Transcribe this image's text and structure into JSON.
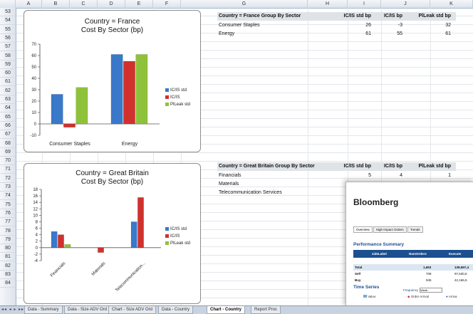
{
  "column_headers": [
    "A",
    "B",
    "C",
    "D",
    "E",
    "F",
    "G",
    "H",
    "I",
    "J",
    "K"
  ],
  "row_numbers": [
    "53",
    "54",
    "55",
    "56",
    "57",
    "58",
    "59",
    "60",
    "61",
    "62",
    "63",
    "64",
    "65",
    "66",
    "67",
    "68",
    "69",
    "70",
    "71",
    "72",
    "73",
    "74",
    "75",
    "76",
    "77",
    "78",
    "79",
    "80",
    "81",
    "82",
    "83",
    "84"
  ],
  "france_table": {
    "header": "Country = France Group By Sector",
    "col1": "IC/IS std bp",
    "col2": "IC/IS bp",
    "col3": "PlLeak std bp",
    "rows": [
      {
        "sector": "Consumer Staples",
        "v1": "26",
        "v2": "-3",
        "v3": "32"
      },
      {
        "sector": "Energy",
        "v1": "61",
        "v2": "55",
        "v3": "61"
      }
    ]
  },
  "gb_table": {
    "header": "Country = Great Britain Group By Sector",
    "col1": "IC/IS std bp",
    "col2": "IC/IS bp",
    "col3": "PlLeak std bp",
    "rows": [
      {
        "sector": "Financials",
        "v1": "5",
        "v2": "4",
        "v3": "1"
      },
      {
        "sector": "Materials",
        "v1": "",
        "v2": "",
        "v3": ""
      },
      {
        "sector": "Telecommunication Services",
        "v1": "",
        "v2": "",
        "v3": ""
      }
    ]
  },
  "chart_data": [
    {
      "type": "bar",
      "title": "Country = France",
      "subtitle": "Cost By Sector (bp)",
      "categories": [
        "Consumer Staples",
        "Energy"
      ],
      "series": [
        {
          "name": "IC/IS std",
          "values": [
            26,
            61
          ],
          "color": "#3a78c9"
        },
        {
          "name": "IC/IS",
          "values": [
            -3,
            55
          ],
          "color": "#d0312d"
        },
        {
          "name": "PlLeak std",
          "values": [
            32,
            61
          ],
          "color": "#8fc23b"
        }
      ],
      "yticks": [
        "70",
        "60",
        "50",
        "40",
        "30",
        "20",
        "10",
        "0",
        "-10"
      ],
      "ylim": [
        -10,
        70
      ],
      "legend": "right"
    },
    {
      "type": "bar",
      "title": "Country = Great Britain",
      "subtitle": "Cost By Sector (bp)",
      "categories": [
        "Financials",
        "Materials",
        "Telecommunication..."
      ],
      "series": [
        {
          "name": "IC/IS std",
          "values": [
            5,
            0,
            8
          ],
          "color": "#3a78c9"
        },
        {
          "name": "IC/IS",
          "values": [
            4,
            -1.5,
            15.5
          ],
          "color": "#d0312d"
        },
        {
          "name": "PlLeak std",
          "values": [
            1,
            0,
            0
          ],
          "color": "#8fc23b"
        }
      ],
      "yticks": [
        "18",
        "16",
        "14",
        "12",
        "10",
        "8",
        "6",
        "4",
        "2",
        "0",
        "-2",
        "-4"
      ],
      "ylim": [
        -4,
        18
      ],
      "legend": "right"
    }
  ],
  "bloomberg": {
    "title": "Bloomberg",
    "tabs": [
      "Overview",
      "High Impact Orders",
      "Trends"
    ],
    "performance_title": "Performance Summary",
    "table_headers": [
      "sideLabel",
      "NumOrders",
      "Execute"
    ],
    "rows": [
      {
        "label": "Total",
        "orders": "1,653",
        "exec": "139,697,4"
      },
      {
        "label": "Sell",
        "orders": "708",
        "exec": "97,530,6"
      },
      {
        "label": "Buy",
        "orders": "945",
        "exec": "42,166,5"
      }
    ],
    "timeseries_title": "Time Series",
    "frequency_label": "Frequency",
    "frequency_value": "Week",
    "legend": [
      "Value",
      "Order Arrival",
      "Arriva"
    ]
  },
  "sheet_tabs": [
    {
      "label": "Data - Summary",
      "active": false
    },
    {
      "label": "Data - Size ADV Ord",
      "active": false
    },
    {
      "label": "Chart - Size ADV Ord",
      "active": false
    },
    {
      "label": "Data - Country",
      "active": false
    },
    {
      "label": "Chart - Country",
      "active": true
    },
    {
      "label": "Report Proc",
      "active": false
    }
  ]
}
